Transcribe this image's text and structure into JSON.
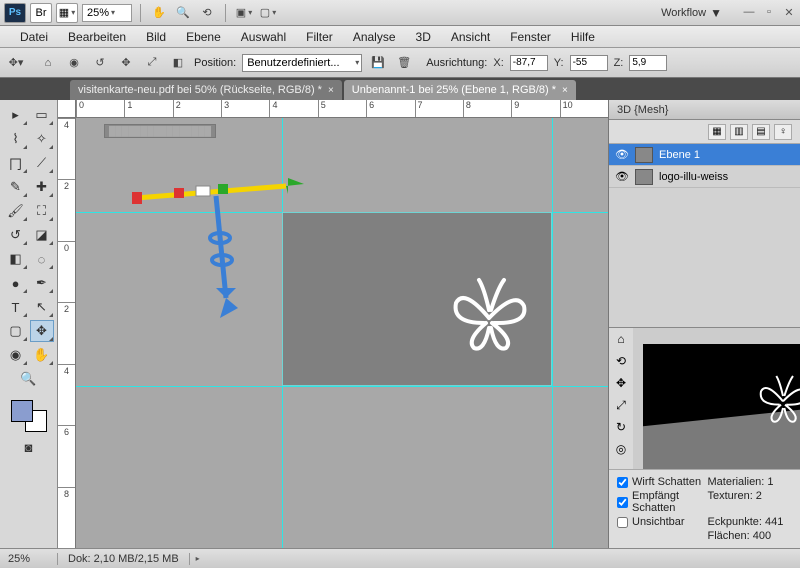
{
  "appbar": {
    "ps": "Ps",
    "br": "Br",
    "zoom": "25%",
    "workflow": "Workflow"
  },
  "menu": [
    "Datei",
    "Bearbeiten",
    "Bild",
    "Ebene",
    "Auswahl",
    "Filter",
    "Analyse",
    "3D",
    "Ansicht",
    "Fenster",
    "Hilfe"
  ],
  "options": {
    "position_label": "Position:",
    "position_value": "Benutzerdefiniert...",
    "orient_label": "Ausrichtung:",
    "x_label": "X:",
    "x_value": "-87,7",
    "y_label": "Y:",
    "y_value": "-55",
    "z_label": "Z:",
    "z_value": "5,9"
  },
  "tabs": [
    {
      "label": "visitenkarte-neu.pdf bei 50% (Rückseite, RGB/8) *",
      "active": false
    },
    {
      "label": "Unbenannt-1 bei 25% (Ebene 1, RGB/8) *",
      "active": true
    }
  ],
  "ruler_h": [
    "0",
    "1",
    "2",
    "3",
    "4",
    "5",
    "6",
    "7",
    "8",
    "9",
    "10"
  ],
  "ruler_v": [
    "4",
    "2",
    "0",
    "2",
    "4",
    "6",
    "8"
  ],
  "panels": {
    "mesh_tab": "3D {Mesh}",
    "layers": [
      {
        "name": "Ebene 1",
        "selected": true
      },
      {
        "name": "logo-illu-weiss",
        "selected": false
      }
    ],
    "cast_shadow": "Wirft Schatten",
    "receive_shadow": "Empfängt Schatten",
    "invisible": "Unsichtbar",
    "materials": "Materialien: 1",
    "textures": "Texturen: 2",
    "vertices": "Eckpunkte: 441",
    "faces": "Flächen: 400"
  },
  "status": {
    "zoom": "25%",
    "doc": "Dok: 2,10 MB/2,15 MB"
  }
}
